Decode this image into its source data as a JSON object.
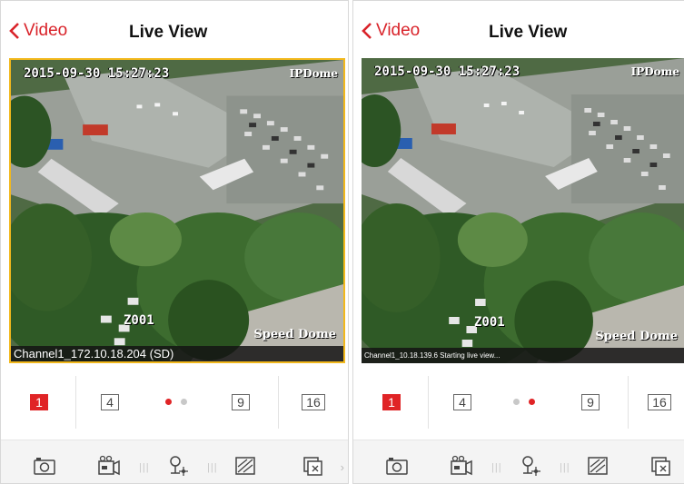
{
  "left": {
    "nav": {
      "back_label": "Video",
      "title": "Live View"
    },
    "video": {
      "osd_time": "2015-09-30 15:27:23",
      "osd_camera": "IPDome",
      "osd_zoom": "Z001",
      "osd_footer": "Speed Dome",
      "status": "Channel1_172.10.18.204 (SD)"
    },
    "layouts": [
      "1",
      "4",
      "9",
      "16"
    ],
    "active_layout": "1",
    "page_index": 0
  },
  "right": {
    "nav": {
      "back_label": "Video",
      "title": "Live View"
    },
    "video": {
      "osd_time": "2015-09-30 15:27:23",
      "osd_camera": "IPDome",
      "osd_zoom": "Z001",
      "osd_footer": "Speed Dome",
      "status": "Channel1_10.18.139.6 Starting live view..."
    },
    "layouts": [
      "1",
      "4",
      "9",
      "16"
    ],
    "active_layout": "1",
    "page_index": 1
  },
  "colors": {
    "accent": "#d9232a",
    "selection_border": "#f2b81c"
  },
  "toolbar_icons": [
    "camera-snapshot-icon",
    "video-record-icon",
    "ptz-control-icon",
    "image-quality-icon",
    "stop-all-icon"
  ]
}
